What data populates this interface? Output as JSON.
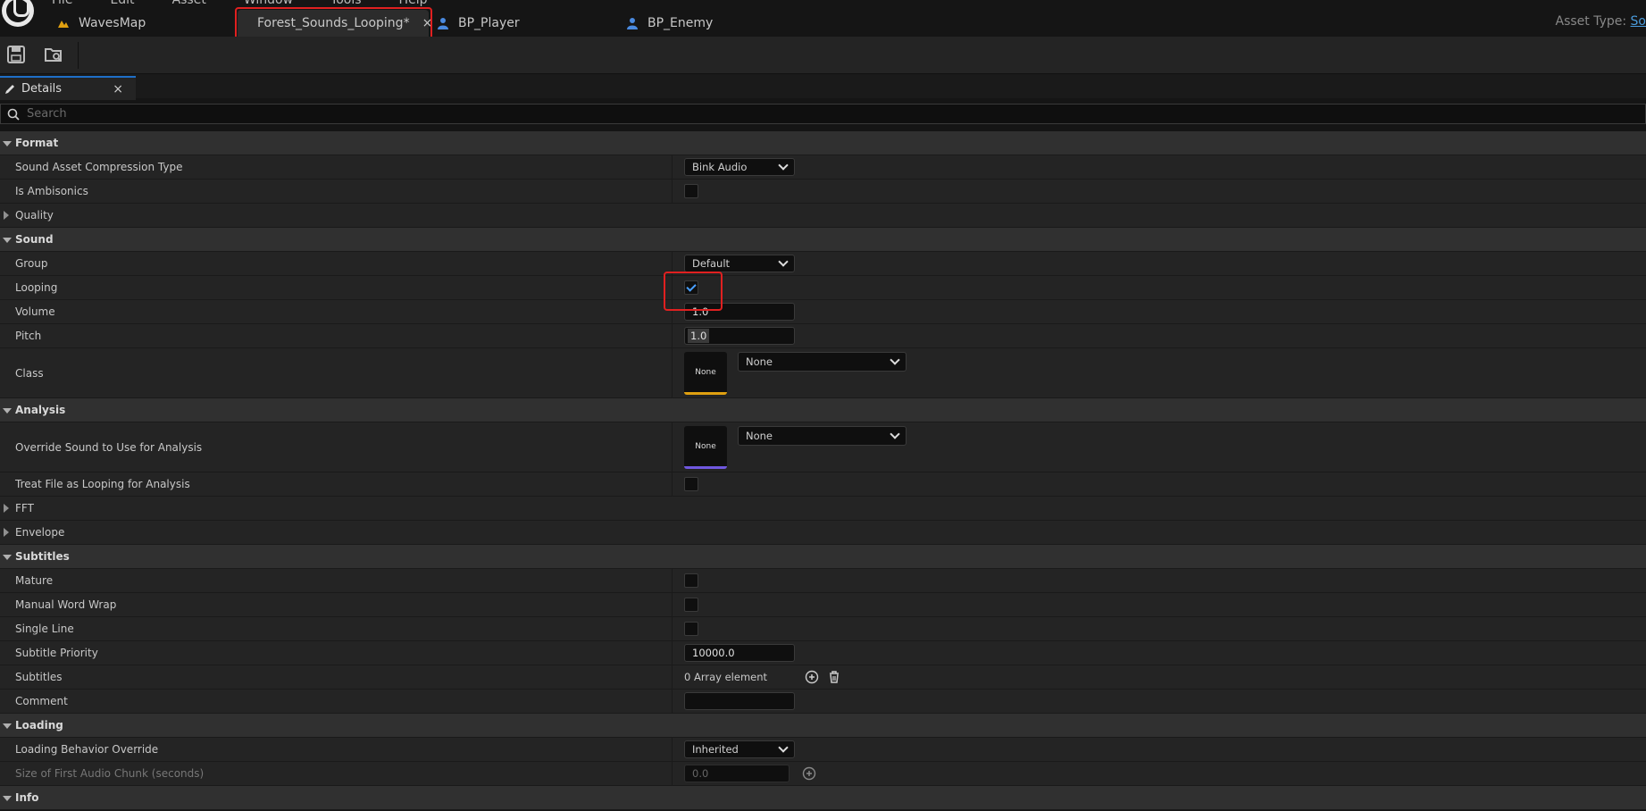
{
  "menu": [
    "File",
    "Edit",
    "Asset",
    "Window",
    "Tools",
    "Help"
  ],
  "tabs": [
    {
      "label": "WavesMap",
      "icon": "level-icon"
    },
    {
      "label": "Forest_Sounds_Looping*",
      "icon": "sound-wave-icon",
      "active": true
    },
    {
      "label": "BP_Player",
      "icon": "blueprint-actor-icon"
    },
    {
      "label": "BP_Enemy",
      "icon": "blueprint-actor-icon"
    }
  ],
  "asset_type": {
    "label": "Asset Type:",
    "value": "So"
  },
  "panel": {
    "tab_label": "Details",
    "close": "×",
    "search_placeholder": "Search"
  },
  "details": {
    "format": {
      "title": "Format",
      "compression_label": "Sound Asset Compression Type",
      "compression_value": "Bink Audio",
      "ambisonics_label": "Is Ambisonics",
      "ambisonics_checked": false,
      "quality_label": "Quality"
    },
    "sound": {
      "title": "Sound",
      "group_label": "Group",
      "group_value": "Default",
      "looping_label": "Looping",
      "looping_checked": true,
      "volume_label": "Volume",
      "volume_value": "1.0",
      "pitch_label": "Pitch",
      "pitch_value": "1.0",
      "class_label": "Class",
      "class_thumb": "None",
      "class_value": "None"
    },
    "analysis": {
      "title": "Analysis",
      "override_label": "Override Sound to Use for Analysis",
      "override_thumb": "None",
      "override_value": "None",
      "treat_label": "Treat File as Looping for Analysis",
      "treat_checked": false,
      "fft_label": "FFT",
      "envelope_label": "Envelope"
    },
    "subtitles": {
      "title": "Subtitles",
      "mature_label": "Mature",
      "wrap_label": "Manual Word Wrap",
      "single_label": "Single Line",
      "priority_label": "Subtitle Priority",
      "priority_value": "10000.0",
      "subs_label": "Subtitles",
      "subs_value": "0 Array element",
      "comment_label": "Comment",
      "comment_value": ""
    },
    "loading": {
      "title": "Loading",
      "behavior_label": "Loading Behavior Override",
      "behavior_value": "Inherited",
      "chunk_label": "Size of First Audio Chunk (seconds)",
      "chunk_value": "0.0"
    },
    "info": {
      "title": "Info"
    }
  },
  "colors": {
    "accent": "#1e6fc8",
    "highlight": "#e02020",
    "check": "#4aa0ff"
  }
}
